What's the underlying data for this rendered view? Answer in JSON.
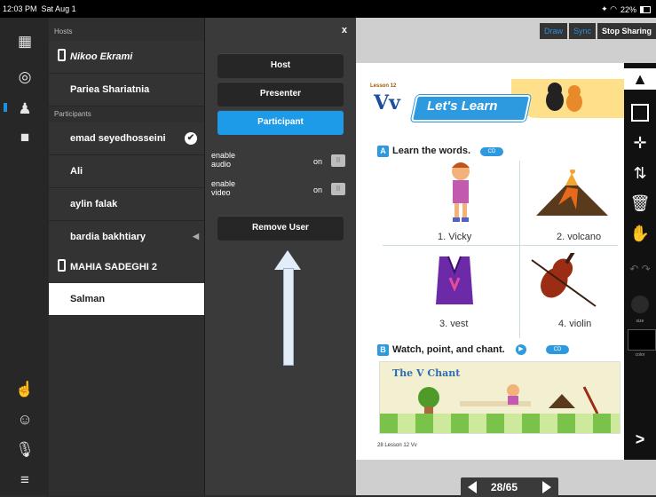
{
  "status_bar": {
    "time": "12:03 PM",
    "date": "Sat Aug 1",
    "battery": "22%"
  },
  "rail": {
    "icons": [
      "screens-icon",
      "target-icon",
      "users-icon",
      "camera-icon",
      "raise-hand-icon",
      "profile-icon",
      "microphone-icon",
      "menu-icon"
    ]
  },
  "users": {
    "hosts_label": "Hosts",
    "participants_label": "Participants",
    "hosts": [
      {
        "name": "Nikoo Ekrami",
        "device": true
      },
      {
        "name": "Pariea Shariatnia"
      }
    ],
    "participants": [
      {
        "name": "emad seyedhosseini",
        "checked": true
      },
      {
        "name": "Ali"
      },
      {
        "name": "aylin  falak"
      },
      {
        "name": "bardia bakhtiary",
        "speaker": true
      },
      {
        "name": "MAHIA SADEGHI 2",
        "device": true
      },
      {
        "name": "Salman",
        "selected": true
      }
    ]
  },
  "role_panel": {
    "close": "x",
    "roles": [
      "Host",
      "Presenter",
      "Participant"
    ],
    "active_role": "Participant",
    "audio": {
      "label_line1": "enable",
      "label_line2": "audio",
      "state": "on"
    },
    "video": {
      "label_line1": "enable",
      "label_line2": "video",
      "state": "on"
    },
    "remove_label": "Remove User"
  },
  "top_actions": {
    "draw": "Draw",
    "sync": "Sync",
    "stop": "Stop Sharing"
  },
  "book": {
    "lesson": "Lesson 12",
    "letters": "Vv",
    "banner_title": "Let's Learn",
    "section_a": "Learn the words.",
    "badge_a": "CD",
    "items": [
      "1. Vicky",
      "2. volcano",
      "3. vest",
      "4. violin"
    ],
    "section_b": "Watch, point, and chant.",
    "badge_b": "CD",
    "chant_title": "The V Chant",
    "page_footer": "28  Lesson 12  Vv",
    "letter_a": "A",
    "letter_b": "B"
  },
  "toolbar": {
    "size_label": "size",
    "color_label": "color",
    "more": ">"
  },
  "pager": {
    "current": "28/65"
  },
  "colors": {
    "accent": "#1e9be8",
    "panel_dark": "#2f2f2f"
  }
}
